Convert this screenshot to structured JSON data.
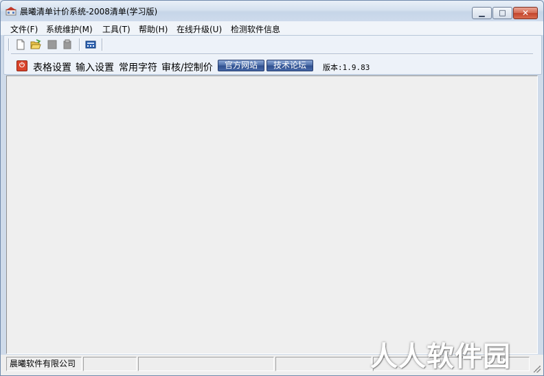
{
  "window": {
    "title": "晨曦清单计价系统-2008清单(学习版)",
    "controls": {
      "minimize": "minimize-icon",
      "maximize": "maximize-icon",
      "close": "close-icon"
    }
  },
  "menubar": {
    "items": [
      {
        "label": "文件(F)"
      },
      {
        "label": "系统维护(M)"
      },
      {
        "label": "工具(T)"
      },
      {
        "label": "帮助(H)"
      },
      {
        "label": "在线升级(U)"
      },
      {
        "label": "检测软件信息"
      }
    ]
  },
  "toolbar": {
    "icons": [
      "new-file-icon",
      "open-folder-icon",
      "save-icon",
      "save-as-icon",
      "calculator-icon"
    ]
  },
  "toolbar2": {
    "items": [
      "表格设置",
      "输入设置",
      "常用字符",
      "审核/控制价"
    ],
    "buttons": [
      "官方网站",
      "技术论坛"
    ],
    "version": "版本:1.9.83"
  },
  "statusbar": {
    "panels": [
      "晨曦软件有限公司",
      "",
      "",
      "",
      ""
    ]
  },
  "watermark": "人人软件园",
  "colors": {
    "title_bar": "#d5e1ef",
    "close_button": "#c2442b",
    "blue_button": "#3a5a99",
    "workspace": "#efefef"
  }
}
